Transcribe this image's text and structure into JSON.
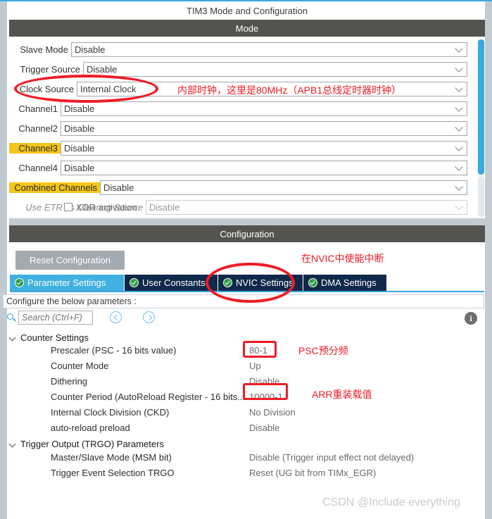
{
  "window": {
    "title": "TIM3 Mode and Configuration"
  },
  "mode_section": {
    "header": "Mode",
    "rows": [
      {
        "label": "Slave Mode",
        "value": "Disable",
        "highlight": false,
        "dim": false
      },
      {
        "label": "Trigger Source",
        "value": "Disable",
        "highlight": false,
        "dim": false
      },
      {
        "label": "Clock Source",
        "value": "Internal Clock",
        "highlight": false,
        "dim": false
      },
      {
        "label": "Channel1",
        "value": "Disable",
        "highlight": false,
        "dim": false
      },
      {
        "label": "Channel2",
        "value": "Disable",
        "highlight": false,
        "dim": false
      },
      {
        "label": "Channel3",
        "value": "Disable",
        "highlight": true,
        "dim": false
      },
      {
        "label": "Channel4",
        "value": "Disable",
        "highlight": false,
        "dim": false
      },
      {
        "label": "Combined Channels",
        "value": "Disable",
        "highlight": true,
        "dim": false
      },
      {
        "label": "Use ETR as Clearing Source",
        "value": "Disable",
        "highlight": false,
        "dim": true
      }
    ],
    "checkbox_partial_label": "XOR activation"
  },
  "config_section": {
    "header": "Configuration",
    "reset_button": "Reset Configuration",
    "tabs": [
      {
        "label": "Parameter Settings",
        "active": true
      },
      {
        "label": "User Constants",
        "active": false
      },
      {
        "label": "NVIC Settings",
        "active": false
      },
      {
        "label": "DMA Settings",
        "active": false
      }
    ],
    "configure_note": "Configure the below parameters :",
    "search_placeholder": "Search (Ctrl+F)",
    "search_value": "",
    "groups": [
      {
        "name": "Counter Settings",
        "params": [
          {
            "name": "Prescaler (PSC - 16 bits value)",
            "value": "80-1"
          },
          {
            "name": "Counter Mode",
            "value": "Up"
          },
          {
            "name": "Dithering",
            "value": "Disable"
          },
          {
            "name": "Counter Period (AutoReload Register - 16 bits...",
            "value": "10000-1"
          },
          {
            "name": "Internal Clock Division (CKD)",
            "value": "No Division"
          },
          {
            "name": "auto-reload preload",
            "value": "Disable"
          }
        ]
      },
      {
        "name": "Trigger Output (TRGO) Parameters",
        "params": [
          {
            "name": "Master/Slave Mode (MSM bit)",
            "value": "Disable (Trigger input effect not delayed)"
          },
          {
            "name": "Trigger Event Selection TRGO",
            "value": "Reset (UG bit from TIMx_EGR)"
          }
        ]
      }
    ]
  },
  "annotations": [
    {
      "id": "clock-source-note",
      "text": "内部时钟，这里是80MHz（APB1总线定时器时钟）"
    },
    {
      "id": "nvic-note",
      "text": "在NVIC中使能中断"
    },
    {
      "id": "psc-note",
      "text": "PSC预分频"
    },
    {
      "id": "arr-note",
      "text": "ARR重装载值"
    }
  ],
  "watermark": {
    "text": "CSDN @Include everything"
  },
  "colors": {
    "accent_blue": "#3aa9e0",
    "tab_active": "#3fb0e0",
    "tab_inactive": "#10284a",
    "section_bar": "#53544f",
    "highlight_yellow": "#f5c518",
    "annotation_red": "#ee1c25",
    "check_green": "#2f9e44"
  }
}
